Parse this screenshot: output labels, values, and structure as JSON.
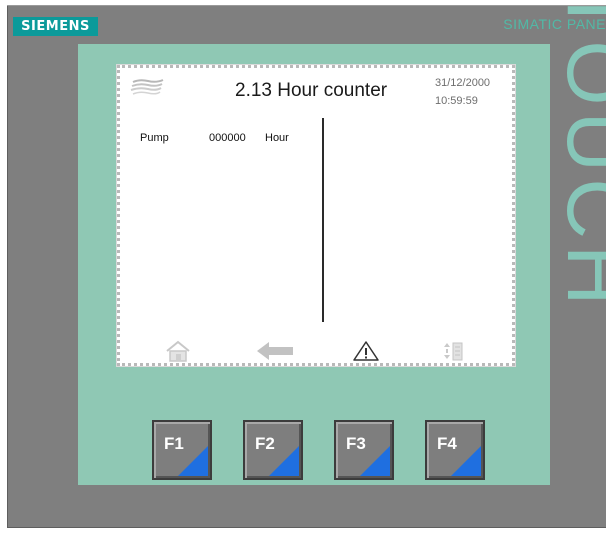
{
  "brand": {
    "name": "SIEMENS",
    "color": "#0b9a9a"
  },
  "panel": {
    "model_text": "SIMATIC PANE",
    "side_text": "TOUCH",
    "body_color": "#8fc8b4",
    "frame_color": "#7f7f7f"
  },
  "screen": {
    "title": "2.13 Hour counter",
    "date": "31/12/2000",
    "time": "10:59:59",
    "row": {
      "name": "Pump",
      "value": "000000",
      "unit": "Hour"
    },
    "nav_icons": [
      "home-icon",
      "back-arrow-icon",
      "warning-icon",
      "settings-icon"
    ]
  },
  "function_keys": [
    {
      "label": "F1"
    },
    {
      "label": "F2"
    },
    {
      "label": "F3"
    },
    {
      "label": "F4"
    }
  ],
  "colors": {
    "key_accent": "#1f6fe0"
  }
}
